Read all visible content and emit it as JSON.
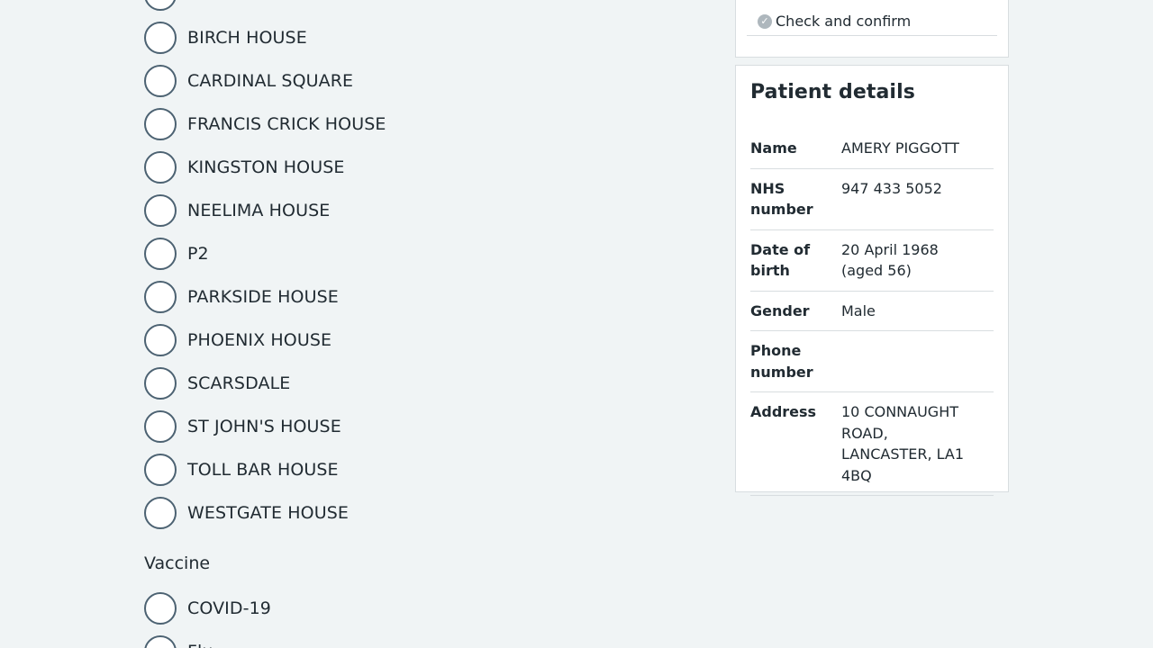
{
  "location_options": [
    {
      "label": ""
    },
    {
      "label": "BIRCH HOUSE"
    },
    {
      "label": "CARDINAL SQUARE"
    },
    {
      "label": "FRANCIS CRICK HOUSE"
    },
    {
      "label": "KINGSTON HOUSE"
    },
    {
      "label": "NEELIMA HOUSE"
    },
    {
      "label": "P2"
    },
    {
      "label": "PARKSIDE HOUSE"
    },
    {
      "label": "PHOENIX HOUSE"
    },
    {
      "label": "SCARSDALE"
    },
    {
      "label": "ST JOHN'S HOUSE"
    },
    {
      "label": "TOLL BAR HOUSE"
    },
    {
      "label": "WESTGATE HOUSE"
    }
  ],
  "vaccine": {
    "legend": "Vaccine",
    "options": [
      {
        "label": "COVID-19"
      },
      {
        "label": "Flu"
      }
    ]
  },
  "steps": {
    "check_confirm": "Check and confirm",
    "check_icon": "check-circle-icon"
  },
  "patient": {
    "title": "Patient details",
    "rows": [
      {
        "key": "Name",
        "value": "AMERY PIGGOTT"
      },
      {
        "key": "NHS number",
        "value": "947 433 5052"
      },
      {
        "key": "Date of birth",
        "value": "20 April 1968 (aged 56)"
      },
      {
        "key": "Gender",
        "value": "Male"
      },
      {
        "key": "Phone number",
        "value": ""
      },
      {
        "key": "Address",
        "value": "10 CONNAUGHT ROAD, LANCASTER, LA1 4BQ"
      }
    ]
  },
  "colors": {
    "background": "#f0f4f5",
    "text": "#212b32",
    "radio_border": "#4c6272",
    "border": "#d8dde0",
    "step_icon": "#aeb7bd"
  }
}
